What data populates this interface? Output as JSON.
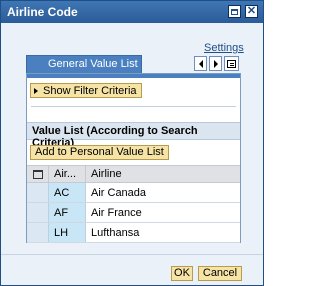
{
  "window": {
    "title": "Airline Code"
  },
  "links": {
    "settings": "Settings"
  },
  "tabs": [
    {
      "label": "General Value List"
    }
  ],
  "filter": {
    "show_label": "Show Filter Criteria"
  },
  "value_list": {
    "header": "Value List (According to Search Criteria)",
    "add_button": "Add to Personal Value List",
    "columns": {
      "code": "Air...",
      "name": "Airline"
    },
    "rows": [
      {
        "code": "AC",
        "name": "Air Canada"
      },
      {
        "code": "AF",
        "name": "Air France"
      },
      {
        "code": "LH",
        "name": "Lufthansa"
      }
    ]
  },
  "footer": {
    "ok": "OK",
    "cancel": "Cancel"
  },
  "colors": {
    "title_bar": "#2a5c98",
    "tab_active": "#4a80bf",
    "button_face": "#f6e3a6",
    "code_cell": "#c9e6f7"
  }
}
